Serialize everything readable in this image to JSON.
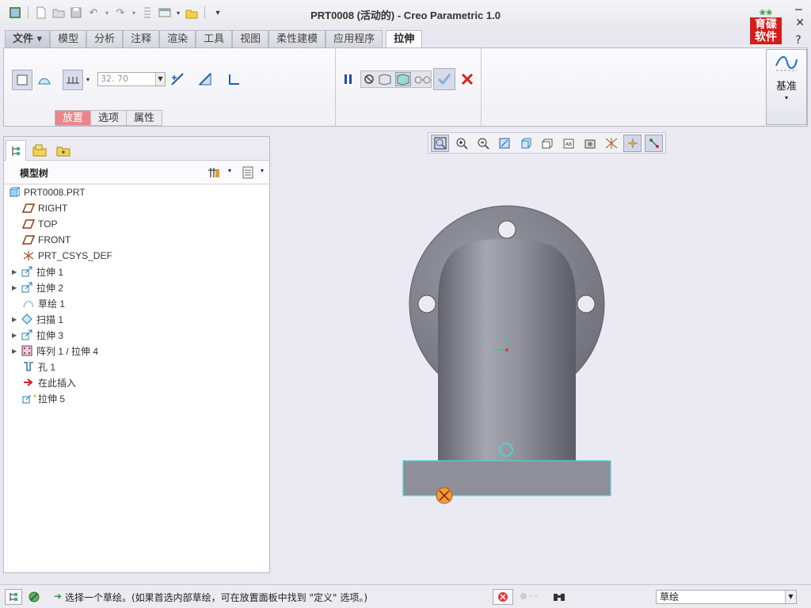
{
  "window": {
    "title": "PRT0008 (活动的) - Creo Parametric 1.0",
    "logo_text_top": "育碟",
    "logo_text_bottom": "软件"
  },
  "ribbon_tabs": [
    {
      "label": "文件 ▾"
    },
    {
      "label": "模型"
    },
    {
      "label": "分析"
    },
    {
      "label": "注释"
    },
    {
      "label": "渲染"
    },
    {
      "label": "工具"
    },
    {
      "label": "视图"
    },
    {
      "label": "柔性建模"
    },
    {
      "label": "应用程序"
    },
    {
      "label": "拉伸"
    }
  ],
  "extrude": {
    "depth_value": "32. 70",
    "subtabs": [
      {
        "label": "放置"
      },
      {
        "label": "选项"
      },
      {
        "label": "属性"
      }
    ],
    "datum_label": "基准"
  },
  "model_tree": {
    "title": "模型树",
    "items": [
      {
        "label": "PRT0008.PRT",
        "icon": "part-icon",
        "expandable": false
      },
      {
        "label": "RIGHT",
        "icon": "datum-plane-icon",
        "expandable": false
      },
      {
        "label": "TOP",
        "icon": "datum-plane-icon",
        "expandable": false
      },
      {
        "label": "FRONT",
        "icon": "datum-plane-icon",
        "expandable": false
      },
      {
        "label": "PRT_CSYS_DEF",
        "icon": "csys-icon",
        "expandable": false
      },
      {
        "label": "拉伸 1",
        "icon": "extrude-icon",
        "expandable": true
      },
      {
        "label": "拉伸 2",
        "icon": "extrude-icon",
        "expandable": true
      },
      {
        "label": "草绘 1",
        "icon": "sketch-icon",
        "expandable": false
      },
      {
        "label": "扫描 1",
        "icon": "sweep-icon",
        "expandable": true
      },
      {
        "label": "拉伸 3",
        "icon": "extrude-icon",
        "expandable": true
      },
      {
        "label": "阵列 1 / 拉伸 4",
        "icon": "pattern-icon",
        "expandable": true
      },
      {
        "label": "孔 1",
        "icon": "hole-icon",
        "expandable": false
      },
      {
        "label": "在此插入",
        "icon": "insert-here-icon",
        "expandable": false
      },
      {
        "label": "拉伸 5",
        "icon": "extrude-new-icon",
        "expandable": false
      }
    ]
  },
  "status_bar": {
    "message": "选择一个草绘。(如果首选内部草绘，可在放置面板中找到 \"定义\" 选项。)",
    "filter_value": "草绘"
  },
  "colors": {
    "accent_tab": "#e9868a",
    "model_gray": "#8e8f99",
    "highlight_edge": "#4fd2cf"
  }
}
